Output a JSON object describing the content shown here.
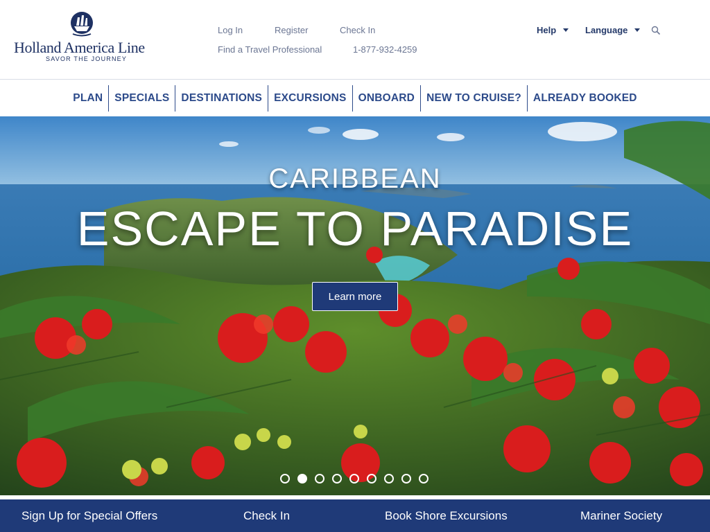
{
  "brand": {
    "name": "Holland America Line",
    "tagline": "SAVOR THE JOURNEY"
  },
  "utility": {
    "login": "Log In",
    "register": "Register",
    "checkin": "Check In",
    "travel_pro": "Find a Travel Professional",
    "phone": "1-877-932-4259",
    "help": "Help",
    "language": "Language"
  },
  "nav": {
    "items": [
      "PLAN",
      "SPECIALS",
      "DESTINATIONS",
      "EXCURSIONS",
      "ONBOARD",
      "NEW TO CRUISE?",
      "ALREADY BOOKED"
    ]
  },
  "hero": {
    "kicker": "CARIBBEAN",
    "title": "ESCAPE TO PARADISE",
    "cta": "Learn more",
    "slide_count": 9,
    "active_slide": 2
  },
  "bottom": {
    "signup": "Sign Up for Special Offers",
    "checkin": "Check In",
    "shore": "Book Shore Excursions",
    "mariner": "Mariner Society"
  },
  "colors": {
    "brand_navy": "#1f3a78",
    "nav_text": "#2c4a8a",
    "util_text": "#6b7693"
  }
}
